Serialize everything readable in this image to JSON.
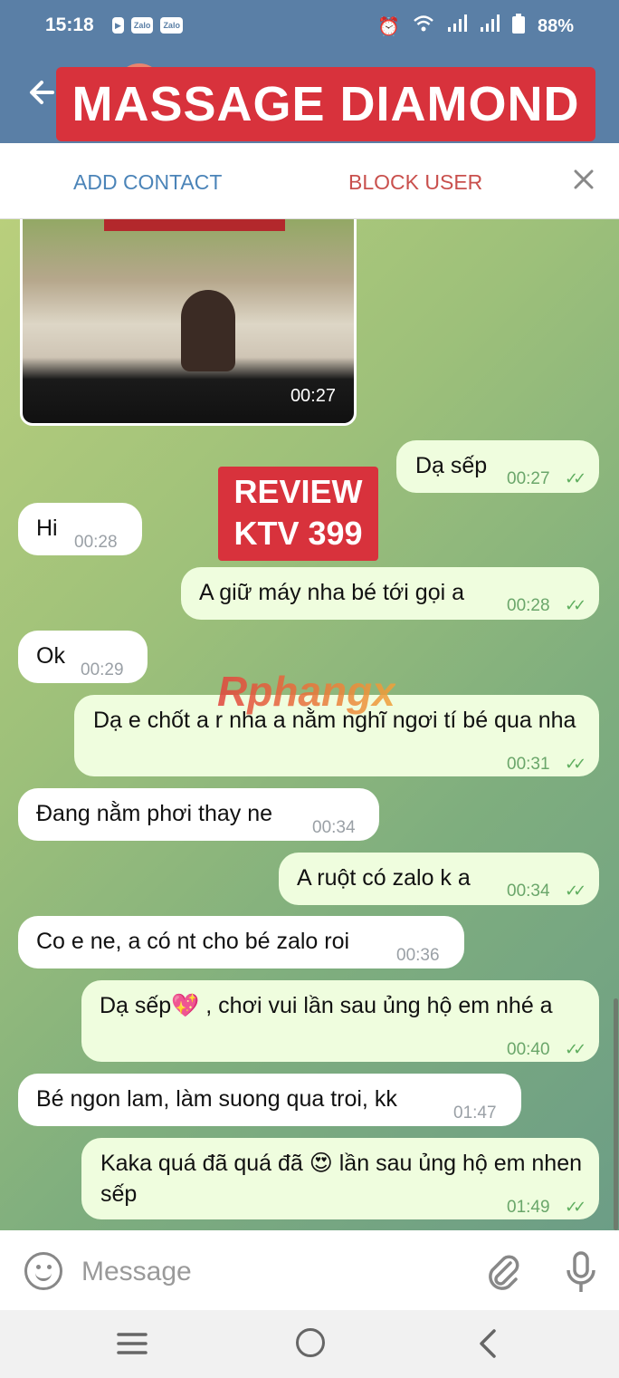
{
  "status_bar": {
    "time": "15:18",
    "left_icons": [
      "youtube-icon",
      "zalo-icon",
      "zalo-icon"
    ],
    "zalo_label": "Zalo",
    "battery": "88%"
  },
  "header": {
    "title": "MASSAGE DIAMOND"
  },
  "action_bar": {
    "add_contact": "ADD CONTACT",
    "block_user": "BLOCK USER"
  },
  "overlay": {
    "review_line1": "REVIEW",
    "review_line2": "KTV 399",
    "watermark": "Rphangx"
  },
  "media": {
    "duration": "00:27"
  },
  "messages": [
    {
      "direction": "out",
      "text": "Dạ sếp",
      "time": "00:27"
    },
    {
      "direction": "in",
      "text": "Hi",
      "time": "00:28"
    },
    {
      "direction": "out",
      "text": "A giữ máy nha bé tới gọi a",
      "time": "00:28"
    },
    {
      "direction": "in",
      "text": "Ok",
      "time": "00:29"
    },
    {
      "direction": "out",
      "text": "Dạ e chốt a r nha a nằm nghĩ ngơi tí bé qua nha",
      "time": "00:31"
    },
    {
      "direction": "in",
      "text": "Đang nằm phơi thay ne",
      "time": "00:34"
    },
    {
      "direction": "out",
      "text": "A ruột có zalo k a",
      "time": "00:34"
    },
    {
      "direction": "in",
      "text": "Co e ne, a có nt cho bé zalo roi",
      "time": "00:36"
    },
    {
      "direction": "out",
      "text": "Dạ sếp💖 , chơi vui lần sau ủng hộ em nhé a",
      "time": "00:40"
    },
    {
      "direction": "in",
      "text": "Bé ngon lam, làm suong qua troi, kk",
      "time": "01:47"
    },
    {
      "direction": "out",
      "text": "Kaka quá đã quá đã 😍 lần sau ủng hộ em nhen sếp",
      "time": "01:49"
    }
  ],
  "input": {
    "placeholder": "Message"
  },
  "colors": {
    "header_bg": "#5a7fa6",
    "title_banner": "#d8323c",
    "add_contact": "#4b84b8",
    "block_user": "#c9504d",
    "outgoing_bubble": "#effdde",
    "incoming_bubble": "#ffffff",
    "read_ticks": "#5fae5f"
  }
}
